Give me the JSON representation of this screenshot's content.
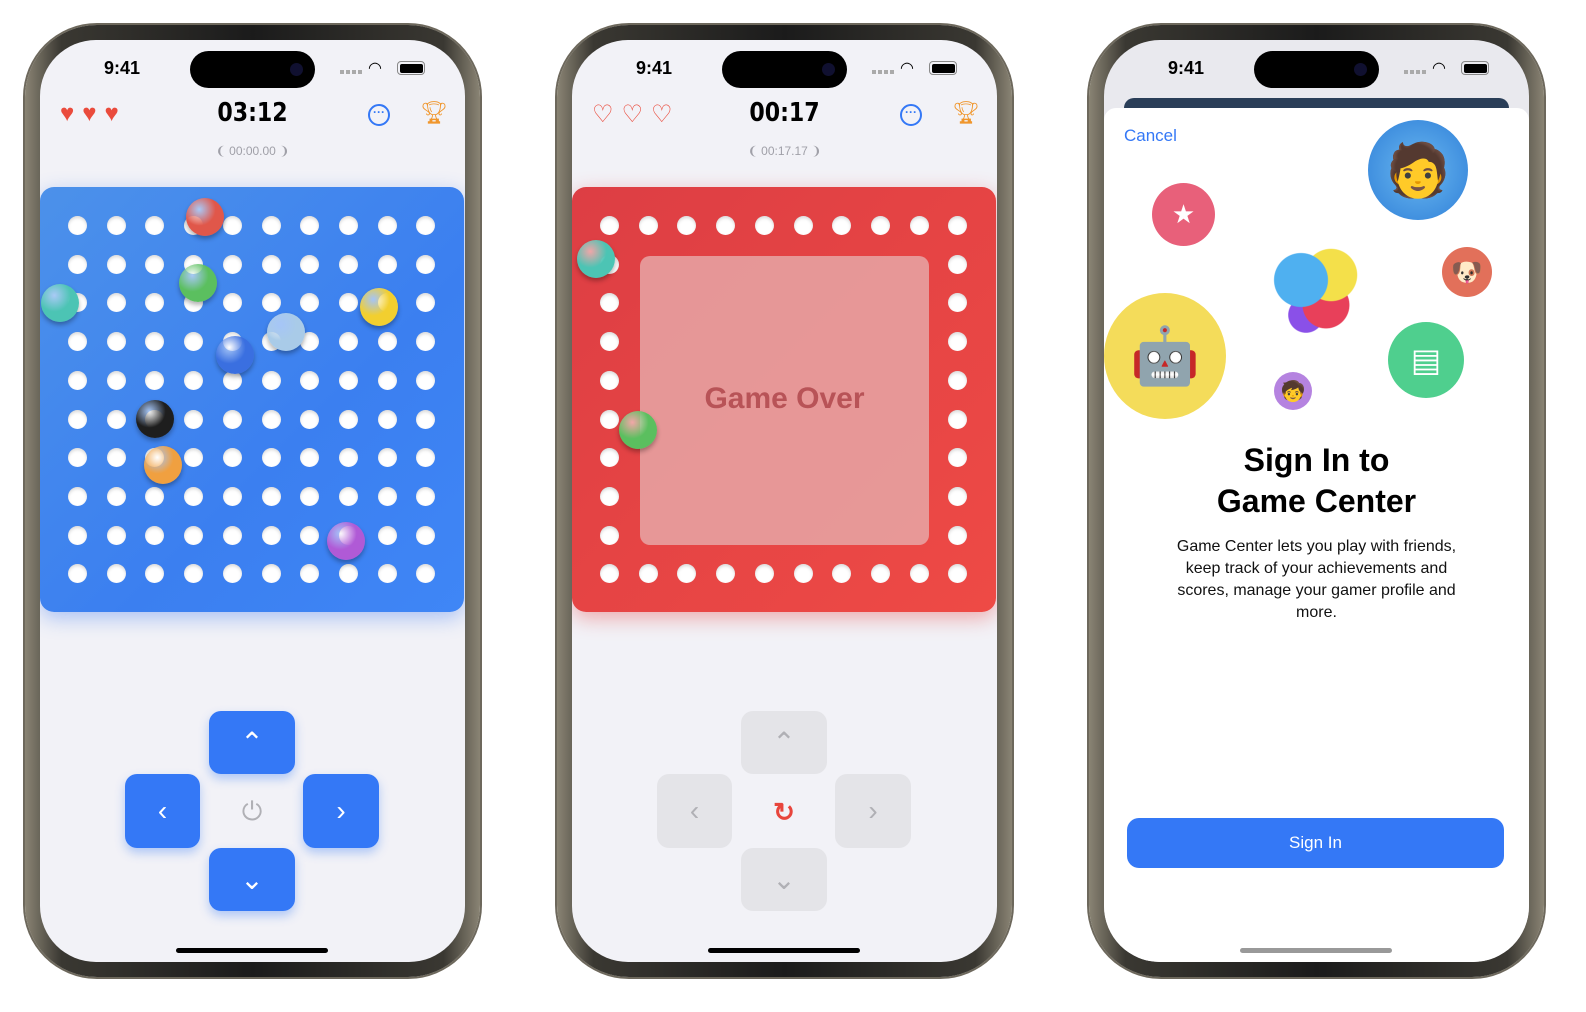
{
  "status_bar": {
    "time": "9:41"
  },
  "phone1": {
    "hearts": "♥♥♥",
    "lives_remaining": 3,
    "timer": "03:12",
    "best_time": "00:00.00",
    "board_color": "#3b82f6",
    "ball_colors": [
      "#e0574a",
      "#5bbf5f",
      "#4cc4b4",
      "#f2cf2f",
      "#a9cbe8",
      "#3a6fe0",
      "#1e1e1e",
      "#f0a040",
      "#b05ad6"
    ],
    "controls": {
      "up": "⌃",
      "left": "‹",
      "right": "›",
      "down": "⌄",
      "center": "⏻"
    }
  },
  "phone2": {
    "hearts": "♡♡♡",
    "lives_remaining": 0,
    "timer": "00:17",
    "best_time": "00:17.17",
    "board_color": "#ea4545",
    "overlay_text": "Game Over",
    "ball_colors": [
      "#4cc4b4",
      "#5bbf5f"
    ],
    "controls": {
      "up": "⌃",
      "left": "‹",
      "right": "›",
      "down": "⌄",
      "center": "↻"
    }
  },
  "phone3": {
    "cancel": "Cancel",
    "title_line1": "Sign In to",
    "title_line2": "Game Center",
    "description": "Game Center lets you play with friends, keep track of your achievements and scores, manage your gamer profile and more.",
    "sign_in_button": "Sign In",
    "accent": "#3478f6"
  },
  "icons": {
    "more": "ellipsis-circle-icon",
    "trophy": "trophy-icon",
    "heart": "heart-icon"
  }
}
